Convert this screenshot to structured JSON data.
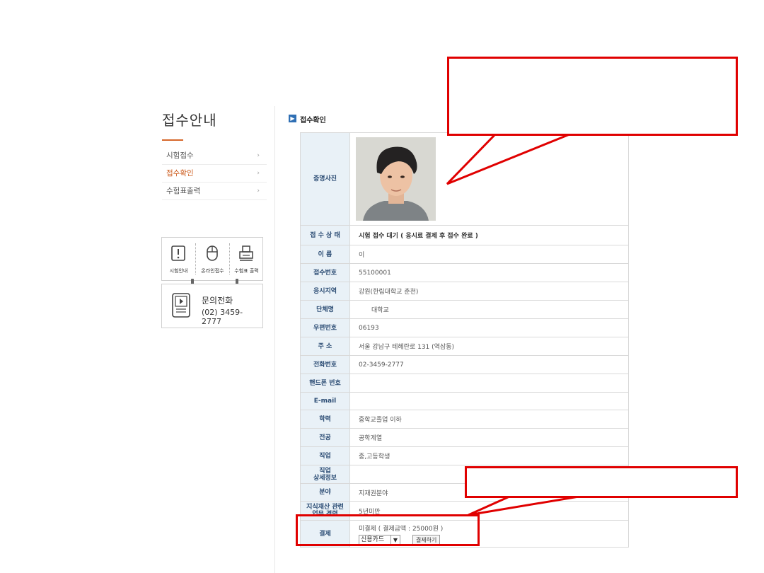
{
  "sidebar": {
    "title": "접수안내",
    "menu": [
      {
        "label": "시험접수",
        "chev": "›"
      },
      {
        "label": "접수확인",
        "chev": "›"
      },
      {
        "label": "수험표출력",
        "chev": "›"
      }
    ],
    "quick": [
      {
        "label": "시험안내",
        "icon": "exclamation-icon"
      },
      {
        "label": "온라인접수",
        "icon": "mouse-icon"
      },
      {
        "label": "수험표 출력",
        "icon": "printer-icon"
      }
    ],
    "phone": {
      "title": "문의전화",
      "number": "(02) 3459-2777",
      "icon": "tablet-phone-icon"
    }
  },
  "section": {
    "icon": "arrow-right-icon",
    "icon_glyph": "▶",
    "title": "접수확인"
  },
  "table": {
    "photo_label": "증명사진",
    "rows": [
      {
        "label": "접 수 상 태",
        "value": "시험 접수 대기 ( 응시료 결제 후 접수 완료 )"
      },
      {
        "label": "이 름",
        "value": "이"
      },
      {
        "label": "접수번호",
        "value": "55100001"
      },
      {
        "label": "응시지역",
        "value": "강원(한림대학교 춘천)"
      },
      {
        "label": "단체명",
        "value": "대학교"
      },
      {
        "label": "우편번호",
        "value": "06193"
      },
      {
        "label": "주 소",
        "value": "서울 강남구 테헤란로 131 (역삼동)"
      },
      {
        "label": "전화번호",
        "value": "02-3459-2777"
      },
      {
        "label": "핸드폰 번호",
        "value": ""
      },
      {
        "label": "E-mail",
        "value": ""
      },
      {
        "label": "학력",
        "value": "중학교졸업 이하"
      },
      {
        "label": "전공",
        "value": "공학계열"
      },
      {
        "label": "직업",
        "value": "중,고등학생"
      },
      {
        "label": "직업\n상세정보",
        "value": ""
      },
      {
        "label": "분야",
        "value": "지재권분야"
      },
      {
        "label": "지식재산 관련\n업무 경력",
        "value": "5년미만"
      }
    ],
    "payment": {
      "label": "결제",
      "status": "미결제 ( 결제금액 : 25000원 )",
      "method": "신용카드",
      "method_arrow": "▼",
      "button": "결제하기"
    }
  },
  "annotation_color": "#e00000"
}
